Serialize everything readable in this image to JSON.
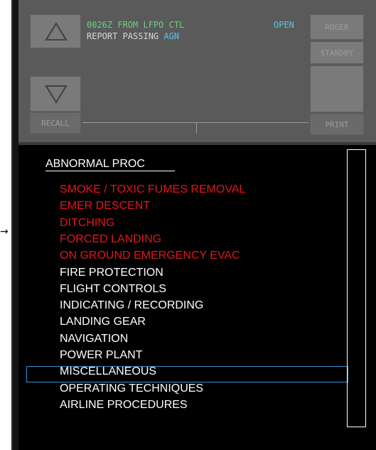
{
  "dcdu": {
    "buttons": {
      "recall": "RECALL",
      "roger": "ROGER",
      "standby": "STANDBY",
      "print": "PRINT"
    },
    "message": {
      "time": "0026Z",
      "from": "FROM LFPO CTL",
      "status": "OPEN",
      "text": "REPORT PASSING",
      "waypoint": "AGN"
    }
  },
  "procedures": {
    "title": "ABNORMAL PROC",
    "items": [
      {
        "label": "SMOKE / TOXIC FUMES REMOVAL",
        "color": "#e1161c"
      },
      {
        "label": "EMER DESCENT",
        "color": "#e1161c"
      },
      {
        "label": "DITCHING",
        "color": "#e1161c"
      },
      {
        "label": "FORCED LANDING",
        "color": "#e1161c"
      },
      {
        "label": "ON GROUND EMERGENCY EVAC",
        "color": "#e1161c"
      },
      {
        "label": "FIRE PROTECTION",
        "color": "#ffffff"
      },
      {
        "label": "FLIGHT CONTROLS",
        "color": "#ffffff"
      },
      {
        "label": "INDICATING / RECORDING",
        "color": "#ffffff"
      },
      {
        "label": "LANDING GEAR",
        "color": "#ffffff"
      },
      {
        "label": "NAVIGATION",
        "color": "#ffffff"
      },
      {
        "label": "POWER PLANT",
        "color": "#ffffff"
      },
      {
        "label": "MISCELLANEOUS",
        "color": "#ffffff"
      },
      {
        "label": "OPERATING TECHNIQUES",
        "color": "#ffffff"
      },
      {
        "label": "AIRLINE PROCEDURES",
        "color": "#ffffff"
      }
    ],
    "selected_label": "MISCELLANEOUS"
  }
}
